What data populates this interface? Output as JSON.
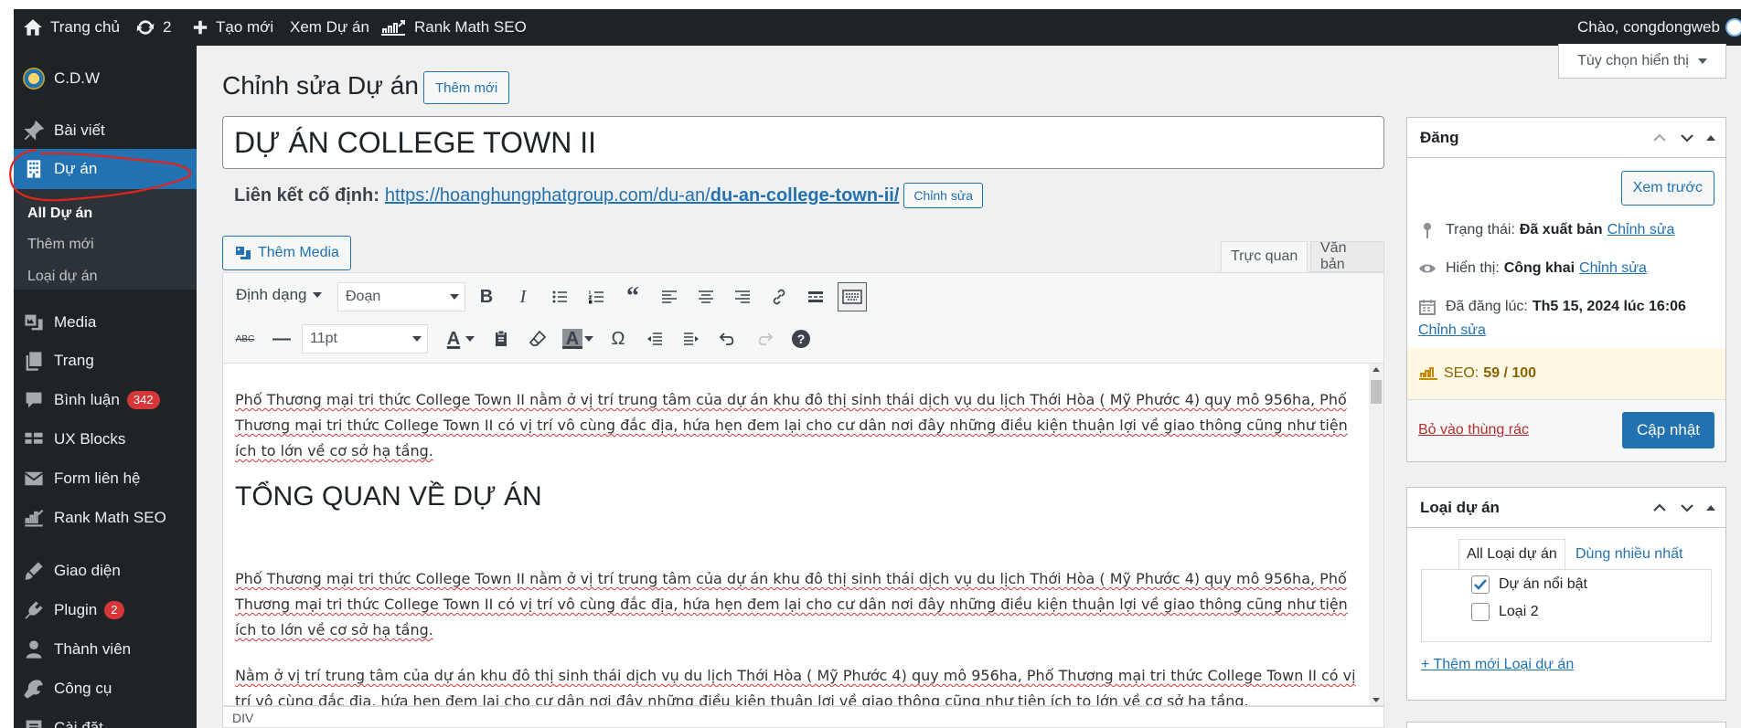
{
  "adminbar": {
    "home": "Trang chủ",
    "updates_count": "2",
    "new": "Tạo mới",
    "view": "Xem Dự án",
    "rankmath": "Rank Math SEO",
    "greeting": "Chào, congdongweb"
  },
  "sidebar": {
    "site": "C.D.W",
    "items": {
      "posts": "Bài viết",
      "projects": "Dự án",
      "media": "Media",
      "pages": "Trang",
      "comments": "Bình luận",
      "comments_badge": "342",
      "uxblocks": "UX Blocks",
      "forms": "Form liên hệ",
      "rankmath": "Rank Math SEO",
      "appearance": "Giao diện",
      "plugins": "Plugin",
      "plugins_badge": "2",
      "users": "Thành viên",
      "tools": "Công cụ",
      "settings": "Cài đặt"
    },
    "submenu": {
      "all": "All Dự án",
      "add": "Thêm mới",
      "types": "Loại dự án"
    }
  },
  "screen_options": "Tùy chọn hiển thị",
  "page": {
    "title": "Chỉnh sửa Dự án",
    "add_new": "Thêm mới",
    "post_title": "DỰ ÁN COLLEGE TOWN II",
    "permalink_label": "Liên kết cố định:",
    "permalink_base": "https://hoanghungphatgroup.com/du-an/",
    "permalink_slug": "du-an-college-town-ii/",
    "permalink_edit": "Chỉnh sửa"
  },
  "editor": {
    "add_media": "Thêm Media",
    "tab_visual": "Trực quan",
    "tab_text": "Văn bản",
    "format_menu": "Định dạng",
    "block_format": "Đoạn",
    "font_size": "11pt",
    "status_path": "DIV",
    "content": {
      "p1": "Phố Thương mại tri thức College Town II nằm ở vị trí trung tâm của dự án khu đô thị sinh thái dịch vụ du lịch Thới Hòa ( Mỹ Phước 4) quy mô 956ha, Phố Thương mại tri thức College Town II có vị trí vô cùng đắc địa, hứa hẹn đem lại cho cư dân nơi đây những điều kiện thuận lợi về giao thông cũng như tiện ích to lớn về cơ sở hạ tầng.",
      "h2": "TỔNG QUAN VỀ DỰ ÁN",
      "p2": "Phố Thương mại tri thức College Town II nằm ở vị trí trung tâm của dự án khu đô thị sinh thái dịch vụ du lịch Thới Hòa ( Mỹ Phước 4) quy mô 956ha, Phố Thương mại tri thức College Town II có vị trí vô cùng đắc địa, hứa hẹn đem lại cho cư dân nơi đây những điều kiện thuận lợi về giao thông cũng như tiện ích to lớn về cơ sở hạ tầng.",
      "p3": "Nằm ở vị trí trung tâm của dự án khu đô thị sinh thái dịch vụ du lịch Thới Hòa  ( Mỹ Phước 4)  quy mô 956ha, Phố Thương mại tri thức College Town II có vị trí vô cùng đắc địa, hứa hẹn đem lại cho cư dân nơi đây những điều kiện thuận lợi về giao thông cũng như tiện ích to lớn về cơ sở hạ tầng."
    }
  },
  "publish": {
    "title": "Đăng",
    "preview": "Xem trước",
    "status_label": "Trạng thái:",
    "status_value": "Đã xuất bản",
    "visibility_label": "Hiển thị:",
    "visibility_value": "Công khai",
    "published_label": "Đã đăng lúc:",
    "published_value": "Th5 15, 2024 lúc 16:06",
    "edit": "Chỉnh sửa",
    "seo_label": "SEO:",
    "seo_score": "59 / 100",
    "trash": "Bỏ vào thùng rác",
    "update": "Cập nhật"
  },
  "project_types": {
    "title": "Loại dự án",
    "tab_all": "All Loại dự án",
    "tab_popular": "Dùng nhiều nhất",
    "options": [
      {
        "label": "Dự án nổi bật",
        "checked": true
      },
      {
        "label": "Loại 2",
        "checked": false
      }
    ],
    "add_new": "+ Thêm mới Loại dự án"
  },
  "colors": {
    "adminbar": "#1d2327",
    "accent": "#2271b1",
    "annotation": "#e0241b",
    "seo_bg": "#fff8e5"
  }
}
